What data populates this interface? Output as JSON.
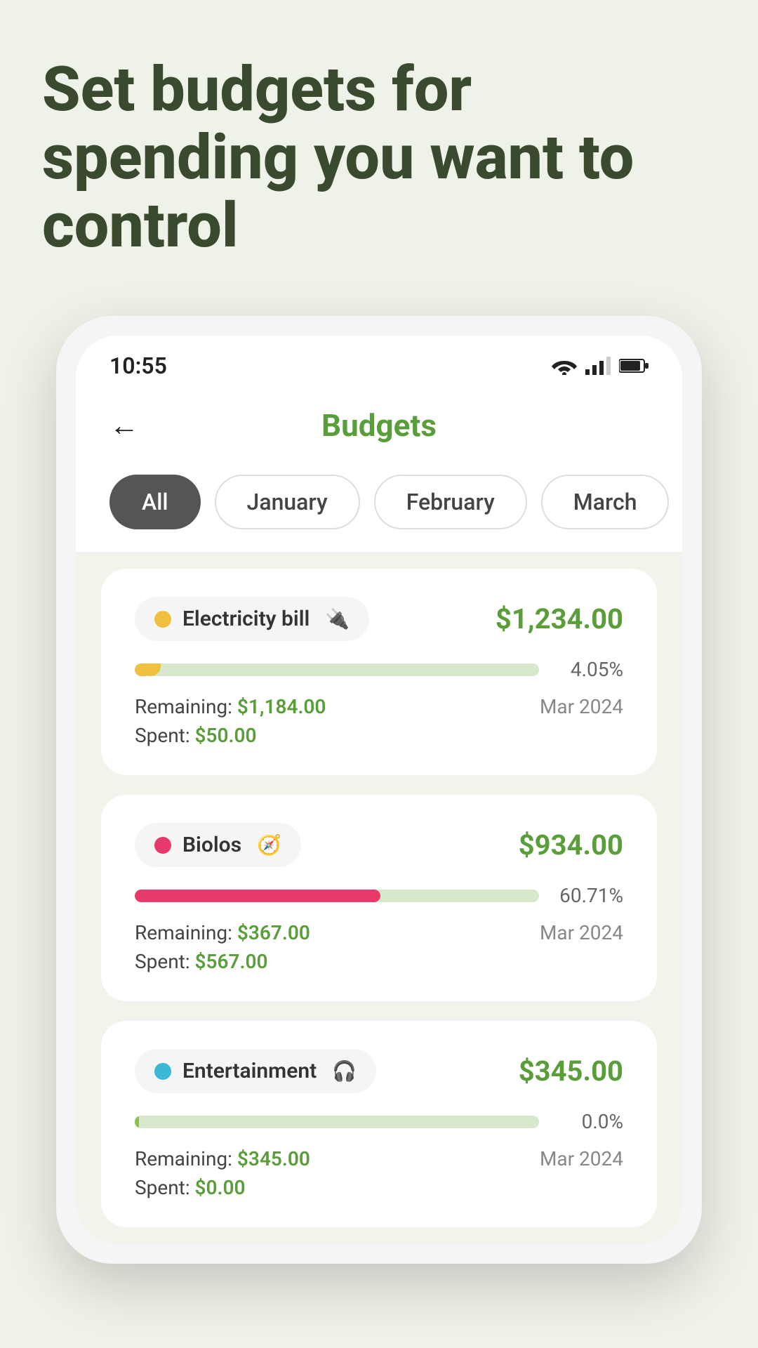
{
  "headline": "Set budgets for spending you want to control",
  "phone": {
    "statusBar": {
      "time": "10:55"
    },
    "header": {
      "backLabel": "←",
      "title": "Budgets"
    },
    "filters": [
      {
        "label": "All",
        "active": true
      },
      {
        "label": "January",
        "active": false
      },
      {
        "label": "February",
        "active": false
      },
      {
        "label": "March",
        "active": false
      }
    ],
    "budgetCards": [
      {
        "categoryName": "Electricity bill",
        "categoryIcon": "🔌",
        "dotColor": "#f0c040",
        "amount": "$1,234.00",
        "progressPct": 4.05,
        "progressFillColor": "#f0c040",
        "progressLabel": "4.05%",
        "remaining": "$1,184.00",
        "spent": "$50.00",
        "date": "Mar 2024"
      },
      {
        "categoryName": "Biolos",
        "categoryIcon": "🧭",
        "dotColor": "#e83a6a",
        "amount": "$934.00",
        "progressPct": 60.71,
        "progressFillColor": "#e83a6a",
        "progressLabel": "60.71%",
        "remaining": "$367.00",
        "spent": "$567.00",
        "date": "Mar 2024"
      },
      {
        "categoryName": "Entertainment",
        "categoryIcon": "🎧",
        "dotColor": "#3ab8d8",
        "amount": "$345.00",
        "progressPct": 0.0,
        "progressFillColor": "#8bc34a",
        "progressLabel": "0.0%",
        "remaining": "$345.00",
        "spent": "$0.00",
        "date": "Mar 2024"
      }
    ]
  }
}
